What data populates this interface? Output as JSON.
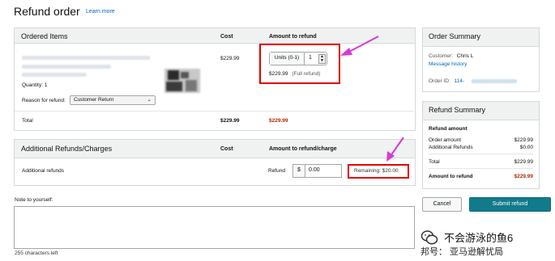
{
  "page": {
    "title": "Refund order",
    "learn_more": "Learn more"
  },
  "ordered_items": {
    "header": "Ordered Items",
    "col_cost": "Cost",
    "col_amount": "Amount to refund",
    "quantity": "Quantity: 1",
    "reason_label": "Reason for refund:",
    "reason_value": "Customer Return",
    "cost": "$229.99",
    "units_label": "Units (0-1)",
    "units_value": "1",
    "refund_amount": "$229.99",
    "refund_note": "(Full refund)",
    "total_label": "Total",
    "total_cost": "$229.99",
    "total_refund": "$229.99"
  },
  "additional": {
    "header": "Additional Refunds/Charges",
    "col_cost": "Cost",
    "col_amount": "Amount to refund/charge",
    "row_label": "Additional refunds",
    "refund_label": "Refund",
    "currency": "$",
    "amount_value": "0.00",
    "remaining": "Remaining: $20.00"
  },
  "note": {
    "label": "Note to yourself:",
    "chars_left": "255 characters left"
  },
  "order_summary": {
    "header": "Order Summary",
    "customer_label": "Customer:",
    "customer_value": "Chris L",
    "message_history": "Message history",
    "order_id_label": "Order ID:",
    "order_id_value": "114-"
  },
  "refund_summary": {
    "header": "Refund Summary",
    "amount_title": "Refund amount",
    "order_amount_label": "Order amount",
    "order_amount_value": "$229.99",
    "additional_label": "Additional Refunds",
    "additional_value": "$0.00",
    "total_label": "Total",
    "total_value": "$229.99",
    "to_refund_label": "Amount to refund",
    "to_refund_value": "$229.99"
  },
  "buttons": {
    "cancel": "Cancel",
    "submit": "Submit refund"
  },
  "watermark": {
    "line1": "不会游泳的鱼6",
    "line2": "邦号： 亚马逊解忧局"
  },
  "colors": {
    "accent_link": "#0066c0",
    "price_red": "#b12704",
    "submit_teal": "#117a8b",
    "annotation_red": "#e00000",
    "annotation_arrow": "#d63ad6"
  }
}
